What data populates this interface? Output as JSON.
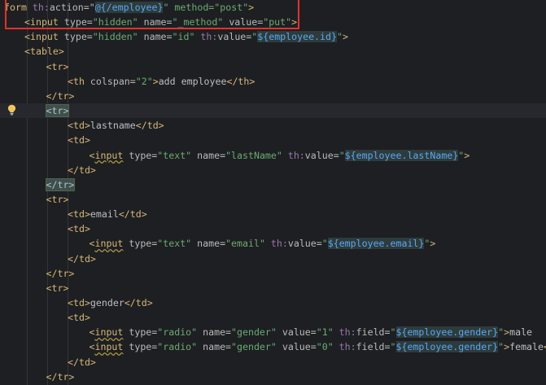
{
  "editor": {
    "lines": [
      {
        "indent": 0,
        "tokens": [
          {
            "t": "form ",
            "c": "tag"
          },
          {
            "t": "th:",
            "c": "th"
          },
          {
            "t": "action=\"",
            "c": "attr"
          },
          {
            "t": "@{/employee}",
            "c": "exprbox"
          },
          {
            "t": "\" method=\"post\"",
            "c": "str"
          },
          {
            "t": ">",
            "c": "punct"
          }
        ]
      },
      {
        "indent": 1,
        "tokens": [
          {
            "t": "<input ",
            "c": "tag"
          },
          {
            "t": "type=",
            "c": "attr"
          },
          {
            "t": "\"hidden\" ",
            "c": "str"
          },
          {
            "t": "name=",
            "c": "attr"
          },
          {
            "t": "\"_method\" ",
            "c": "str"
          },
          {
            "t": "value=",
            "c": "attr"
          },
          {
            "t": "\"put\"",
            "c": "str"
          },
          {
            "t": ">",
            "c": "punct"
          }
        ]
      },
      {
        "indent": 1,
        "tokens": [
          {
            "t": "<input ",
            "c": "tag"
          },
          {
            "t": "type=",
            "c": "attr"
          },
          {
            "t": "\"hidden\" ",
            "c": "str"
          },
          {
            "t": "name=",
            "c": "attr"
          },
          {
            "t": "\"id\" ",
            "c": "str"
          },
          {
            "t": "th:",
            "c": "th"
          },
          {
            "t": "value=",
            "c": "attr"
          },
          {
            "t": "\"",
            "c": "str"
          },
          {
            "t": "${employee.id}",
            "c": "exprbox"
          },
          {
            "t": "\"",
            "c": "str"
          },
          {
            "t": ">",
            "c": "punct"
          }
        ]
      },
      {
        "indent": 1,
        "tokens": [
          {
            "t": "<table>",
            "c": "tag"
          }
        ]
      },
      {
        "indent": 2,
        "tokens": [
          {
            "t": "<tr>",
            "c": "tag"
          }
        ]
      },
      {
        "indent": 3,
        "tokens": [
          {
            "t": "<th ",
            "c": "tag"
          },
          {
            "t": "colspan=",
            "c": "attr"
          },
          {
            "t": "\"2\"",
            "c": "str"
          },
          {
            "t": ">",
            "c": "punct"
          },
          {
            "t": "add employee",
            "c": "delim"
          },
          {
            "t": "</th>",
            "c": "tag"
          }
        ]
      },
      {
        "indent": 2,
        "tokens": [
          {
            "t": "</tr>",
            "c": "tag"
          }
        ]
      },
      {
        "indent": 2,
        "current": true,
        "tokens": [
          {
            "t": "<tr>",
            "c": "tagbox"
          }
        ]
      },
      {
        "indent": 3,
        "tokens": [
          {
            "t": "<td>",
            "c": "tag"
          },
          {
            "t": "lastname",
            "c": "delim"
          },
          {
            "t": "</td>",
            "c": "tag"
          }
        ]
      },
      {
        "indent": 3,
        "tokens": [
          {
            "t": "<td>",
            "c": "tag"
          }
        ]
      },
      {
        "indent": 4,
        "tokens": [
          {
            "t": "<",
            "c": "tag"
          },
          {
            "t": "input",
            "c": "tag squiggle"
          },
          {
            "t": " type=",
            "c": "attr"
          },
          {
            "t": "\"text\" ",
            "c": "str"
          },
          {
            "t": "name=",
            "c": "attr"
          },
          {
            "t": "\"lastName\" ",
            "c": "str"
          },
          {
            "t": "th:",
            "c": "th"
          },
          {
            "t": "value=",
            "c": "attr"
          },
          {
            "t": "\"",
            "c": "str"
          },
          {
            "t": "${employee.lastName}",
            "c": "exprbox"
          },
          {
            "t": "\"",
            "c": "str"
          },
          {
            "t": ">",
            "c": "punct"
          }
        ]
      },
      {
        "indent": 3,
        "tokens": [
          {
            "t": "</td>",
            "c": "tag"
          }
        ]
      },
      {
        "indent": 2,
        "tokens": [
          {
            "t": "</tr>",
            "c": "tagbox"
          }
        ]
      },
      {
        "indent": 2,
        "tokens": [
          {
            "t": "<tr>",
            "c": "tag"
          }
        ]
      },
      {
        "indent": 3,
        "tokens": [
          {
            "t": "<td>",
            "c": "tag"
          },
          {
            "t": "email",
            "c": "delim"
          },
          {
            "t": "</td>",
            "c": "tag"
          }
        ]
      },
      {
        "indent": 3,
        "tokens": [
          {
            "t": "<td>",
            "c": "tag"
          }
        ]
      },
      {
        "indent": 4,
        "tokens": [
          {
            "t": "<",
            "c": "tag"
          },
          {
            "t": "input",
            "c": "tag squiggle"
          },
          {
            "t": " type=",
            "c": "attr"
          },
          {
            "t": "\"text\" ",
            "c": "str"
          },
          {
            "t": "name=",
            "c": "attr"
          },
          {
            "t": "\"email\" ",
            "c": "str"
          },
          {
            "t": "th:",
            "c": "th"
          },
          {
            "t": "value=",
            "c": "attr"
          },
          {
            "t": "\"",
            "c": "str"
          },
          {
            "t": "${employee.email}",
            "c": "exprbox"
          },
          {
            "t": "\"",
            "c": "str"
          },
          {
            "t": ">",
            "c": "punct"
          }
        ]
      },
      {
        "indent": 3,
        "tokens": [
          {
            "t": "</td>",
            "c": "tag"
          }
        ]
      },
      {
        "indent": 2,
        "tokens": [
          {
            "t": "</tr>",
            "c": "tag"
          }
        ]
      },
      {
        "indent": 2,
        "tokens": [
          {
            "t": "<tr>",
            "c": "tag"
          }
        ]
      },
      {
        "indent": 3,
        "tokens": [
          {
            "t": "<td>",
            "c": "tag"
          },
          {
            "t": "gender",
            "c": "delim"
          },
          {
            "t": "</td>",
            "c": "tag"
          }
        ]
      },
      {
        "indent": 3,
        "tokens": [
          {
            "t": "<td>",
            "c": "tag"
          }
        ]
      },
      {
        "indent": 4,
        "tokens": [
          {
            "t": "<",
            "c": "tag"
          },
          {
            "t": "input",
            "c": "tag squiggle"
          },
          {
            "t": " type=",
            "c": "attr"
          },
          {
            "t": "\"radio\" ",
            "c": "str"
          },
          {
            "t": "name=",
            "c": "attr"
          },
          {
            "t": "\"gender\" ",
            "c": "str"
          },
          {
            "t": "value=",
            "c": "attr"
          },
          {
            "t": "\"1\" ",
            "c": "str"
          },
          {
            "t": "th:",
            "c": "th"
          },
          {
            "t": "field=",
            "c": "attr"
          },
          {
            "t": "\"",
            "c": "str"
          },
          {
            "t": "${employee.gender}",
            "c": "exprbox"
          },
          {
            "t": "\"",
            "c": "str"
          },
          {
            "t": ">",
            "c": "punct"
          },
          {
            "t": "male",
            "c": "delim"
          }
        ]
      },
      {
        "indent": 4,
        "tokens": [
          {
            "t": "<",
            "c": "tag"
          },
          {
            "t": "input",
            "c": "tag squiggle"
          },
          {
            "t": " type=",
            "c": "attr"
          },
          {
            "t": "\"radio\" ",
            "c": "str"
          },
          {
            "t": "name=",
            "c": "attr"
          },
          {
            "t": "\"gender\" ",
            "c": "str"
          },
          {
            "t": "value=",
            "c": "attr"
          },
          {
            "t": "\"0\" ",
            "c": "str"
          },
          {
            "t": "th:",
            "c": "th"
          },
          {
            "t": "field=",
            "c": "attr"
          },
          {
            "t": "\"",
            "c": "str"
          },
          {
            "t": "${employee.gender}",
            "c": "exprbox"
          },
          {
            "t": "\"",
            "c": "str"
          },
          {
            "t": ">",
            "c": "punct"
          },
          {
            "t": "female",
            "c": "delim"
          },
          {
            "t": "<br>",
            "c": "tag"
          }
        ]
      },
      {
        "indent": 3,
        "tokens": [
          {
            "t": "</td>",
            "c": "tag"
          }
        ]
      },
      {
        "indent": 2,
        "tokens": [
          {
            "t": "</tr>",
            "c": "tag"
          }
        ]
      }
    ]
  },
  "gutter": {
    "intention_icon": "lightbulb-icon"
  },
  "highlight": {
    "color": "#e0312f"
  }
}
